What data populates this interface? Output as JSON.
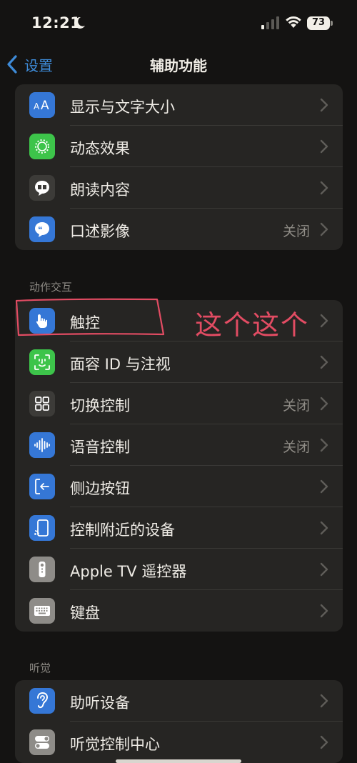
{
  "status_bar": {
    "time": "12:21",
    "battery": "73",
    "icons": [
      "moon-icon",
      "cellular-signal-icon",
      "wifi-icon",
      "battery-icon"
    ]
  },
  "nav": {
    "back_label": "设置",
    "title": "辅助功能"
  },
  "vision_group": {
    "items": [
      {
        "label": "显示与文字大小",
        "value": "",
        "icon": "text-size-icon",
        "color": "#3577d6"
      },
      {
        "label": "动态效果",
        "value": "",
        "icon": "motion-icon",
        "color": "#3dc44a"
      },
      {
        "label": "朗读内容",
        "value": "",
        "icon": "spoken-content-icon",
        "color": "#3c3b38"
      },
      {
        "label": "口述影像",
        "value": "关闭",
        "icon": "audio-description-icon",
        "color": "#3577d6"
      }
    ]
  },
  "interaction_group": {
    "header": "动作交互",
    "items": [
      {
        "label": "触控",
        "value": "",
        "icon": "touch-icon",
        "color": "#3577d6"
      },
      {
        "label": "面容 ID 与注视",
        "value": "",
        "icon": "face-id-icon",
        "color": "#3dc44a"
      },
      {
        "label": "切换控制",
        "value": "关闭",
        "icon": "switch-control-icon",
        "color": "#3c3b38"
      },
      {
        "label": "语音控制",
        "value": "关闭",
        "icon": "voice-control-icon",
        "color": "#3577d6"
      },
      {
        "label": "侧边按钮",
        "value": "",
        "icon": "side-button-icon",
        "color": "#3577d6"
      },
      {
        "label": "控制附近的设备",
        "value": "",
        "icon": "nearby-devices-icon",
        "color": "#3577d6"
      },
      {
        "label": "Apple TV 遥控器",
        "value": "",
        "icon": "tv-remote-icon",
        "color": "#8e8c88"
      },
      {
        "label": "键盘",
        "value": "",
        "icon": "keyboard-icon",
        "color": "#8e8c88"
      }
    ]
  },
  "hearing_group": {
    "header": "听觉",
    "items": [
      {
        "label": "助听设备",
        "value": "",
        "icon": "hearing-devices-icon",
        "color": "#3577d6"
      },
      {
        "label": "听觉控制中心",
        "value": "",
        "icon": "hearing-control-center-icon",
        "color": "#8e8c88"
      }
    ]
  },
  "annotation": {
    "text": "这个这个",
    "color": "#e24c63"
  },
  "colors": {
    "accent": "#3e8bd8",
    "background": "#141312",
    "cell": "#262523"
  }
}
